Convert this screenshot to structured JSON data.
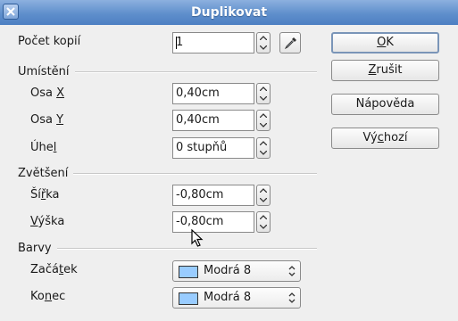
{
  "window": {
    "title": "Duplikovat"
  },
  "copies": {
    "label": "Počet kopií",
    "value": "1"
  },
  "placement": {
    "heading": "Umístění",
    "x_pre": "Osa ",
    "x_key": "X",
    "x_value": "0,40cm",
    "y_pre": "Osa ",
    "y_key": "Y",
    "y_value": "0,40cm",
    "angle_pre": "Úhe",
    "angle_key": "l",
    "angle_value": "0 stupňů"
  },
  "enlargement": {
    "heading": "Zvětšení",
    "width_pre": "Ší",
    "width_key": "ř",
    "width_post": "ka",
    "width_value": "-0,80cm",
    "height_key": "V",
    "height_post": "ýška",
    "height_value": "-0,80cm"
  },
  "colors": {
    "heading": "Barvy",
    "start_pre": "Začá",
    "start_key": "t",
    "start_post": "ek",
    "start_value": "Modrá 8",
    "end_pre": "Ko",
    "end_key": "n",
    "end_post": "ec",
    "end_value": "Modrá 8",
    "swatch_color": "#99ccff"
  },
  "buttons": {
    "ok_key": "O",
    "ok_post": "K",
    "cancel_key": "Z",
    "cancel_post": "rušit",
    "help_label": "Nápověda",
    "default_pre": "Vý",
    "default_key": "c",
    "default_post": "hozí"
  },
  "icons": {
    "close": "close-icon",
    "picker": "eyedropper-icon"
  },
  "theme": {
    "titlebar": "#5f8fcc",
    "background": "#efefef"
  }
}
